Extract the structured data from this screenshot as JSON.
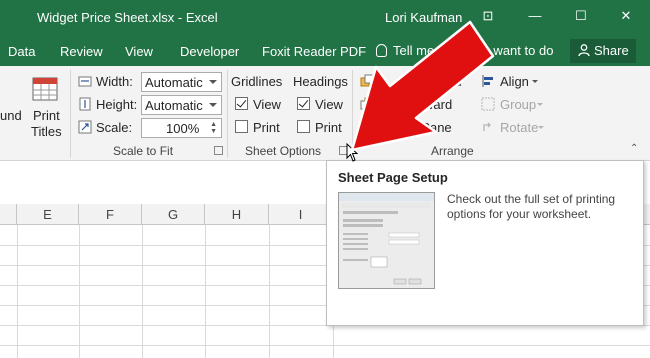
{
  "window": {
    "title": "Widget Price Sheet.xlsx - Excel",
    "user": "Lori Kaufman",
    "controls": {
      "restore": "⊡",
      "minimize": "—",
      "maximize": "☐",
      "close": "✕"
    }
  },
  "tabs": {
    "data": "Data",
    "review": "Review",
    "view": "View",
    "developer": "Developer",
    "foxit": "Foxit Reader PDF",
    "tell_me": "Tell me what you want to do",
    "share": "Share"
  },
  "ribbon": {
    "margins_fragment": "und",
    "print_titles_line1": "Print",
    "print_titles_line2": "Titles",
    "width_label": "Width:",
    "width_value": "Automatic",
    "height_label": "Height:",
    "height_value": "Automatic",
    "scale_label": "Scale:",
    "scale_value": "100%",
    "scale_group": "Scale to Fit",
    "gridlines_header": "Gridlines",
    "gridlines_view": "View",
    "gridlines_view_checked": true,
    "gridlines_print": "Print",
    "gridlines_print_checked": false,
    "headings_header": "Headings",
    "headings_view": "View",
    "headings_view_checked": true,
    "headings_print": "Print",
    "headings_print_checked": false,
    "sheet_options_group": "Sheet Options",
    "bring_forward_fragment": "rd",
    "send_backward_fragment": "ward",
    "selection_pane_fragment": "ection Pane",
    "align": "Align",
    "group": "Group",
    "rotate": "Rotate",
    "arrange_group": "Arrange"
  },
  "sheet": {
    "columns": [
      "E",
      "F",
      "G",
      "H",
      "I"
    ]
  },
  "tooltip": {
    "title": "Sheet Page Setup",
    "description": "Check out the full set of printing options for your worksheet."
  },
  "colors": {
    "excel_green": "#217346",
    "arrow_red": "#e01010"
  }
}
